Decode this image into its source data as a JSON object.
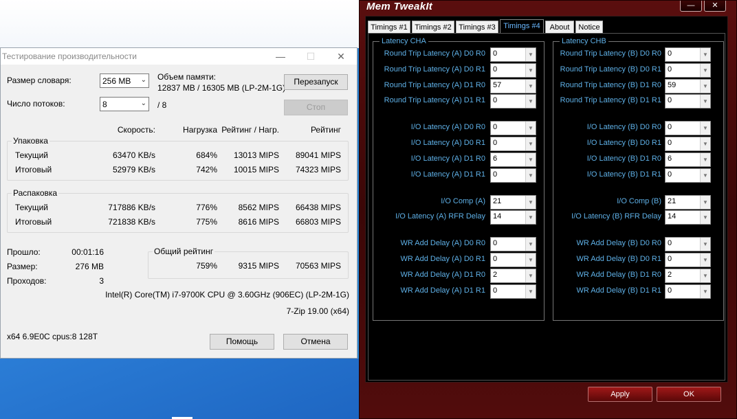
{
  "bench": {
    "title": "Тестирование производительности",
    "dict_label": "Размер словаря:",
    "dict_value": "256 MB",
    "threads_label": "Число потоков:",
    "threads_value": "8",
    "threads_max": "/ 8",
    "mem_label": "Объем памяти:",
    "mem_value": "12837 MB / 16305 MB (LP-2M-1G)",
    "restart_btn": "Перезапуск",
    "stop_btn": "Стоп",
    "col_speed": "Скорость:",
    "col_load": "Нагрузка",
    "col_rating_load": "Рейтинг / Нагр.",
    "col_rating": "Рейтинг",
    "pack": {
      "caption": "Упаковка",
      "rows": [
        {
          "label": "Текущий",
          "speed": "63470 KB/s",
          "load": "684%",
          "rl": "13013 MIPS",
          "rating": "89041 MIPS"
        },
        {
          "label": "Итоговый",
          "speed": "52979 KB/s",
          "load": "742%",
          "rl": "10015 MIPS",
          "rating": "74323 MIPS"
        }
      ]
    },
    "unpack": {
      "caption": "Распаковка",
      "rows": [
        {
          "label": "Текущий",
          "speed": "717886 KB/s",
          "load": "776%",
          "rl": "8562 MIPS",
          "rating": "66438 MIPS"
        },
        {
          "label": "Итоговый",
          "speed": "721838 KB/s",
          "load": "775%",
          "rl": "8616 MIPS",
          "rating": "66803 MIPS"
        }
      ]
    },
    "elapsed_label": "Прошло:",
    "elapsed_value": "00:01:16",
    "size_label": "Размер:",
    "size_value": "276 MB",
    "passes_label": "Проходов:",
    "passes_value": "3",
    "total": {
      "caption": "Общий рейтинг",
      "load": "759%",
      "rl": "9315 MIPS",
      "rating": "70563 MIPS"
    },
    "cpu_info": "Intel(R) Core(TM) i7-9700K CPU @ 3.60GHz (906EC) (LP-2M-1G)",
    "version": "7-Zip 19.00 (x64)",
    "sys_info": "x64 6.9E0C cpus:8 128T",
    "help_btn": "Помощь",
    "cancel_btn": "Отмена"
  },
  "mt": {
    "title": "Mem TweakIt",
    "tabs": [
      "Timings #1",
      "Timings #2",
      "Timings #3",
      "Timings #4",
      "About",
      "Notice"
    ],
    "active_tab": "Timings #4",
    "cha": {
      "caption": "Latency CHA",
      "fields": [
        {
          "label": "Round Trip Latency (A) D0 R0",
          "value": "0"
        },
        {
          "label": "Round Trip Latency (A) D0 R1",
          "value": "0"
        },
        {
          "label": "Round Trip Latency (A) D1 R0",
          "value": "57"
        },
        {
          "label": "Round Trip Latency (A) D1 R1",
          "value": "0"
        },
        {
          "label": "I/O Latency (A) D0 R0",
          "value": "0"
        },
        {
          "label": "I/O Latency (A) D0 R1",
          "value": "0"
        },
        {
          "label": "I/O Latency (A) D1 R0",
          "value": "6"
        },
        {
          "label": "I/O Latency (A) D1 R1",
          "value": "0"
        },
        {
          "label": "I/O Comp (A)",
          "value": "21"
        },
        {
          "label": "I/O Latency (A) RFR Delay",
          "value": "14"
        },
        {
          "label": "WR Add Delay (A) D0 R0",
          "value": "0"
        },
        {
          "label": "WR Add Delay (A) D0 R1",
          "value": "0"
        },
        {
          "label": "WR Add Delay (A) D1 R0",
          "value": "2"
        },
        {
          "label": "WR Add Delay (A) D1 R1",
          "value": "0"
        }
      ]
    },
    "chb": {
      "caption": "Latency CHB",
      "fields": [
        {
          "label": "Round Trip Latency (B) D0 R0",
          "value": "0"
        },
        {
          "label": "Round Trip Latency (B) D0 R1",
          "value": "0"
        },
        {
          "label": "Round Trip Latency (B) D1 R0",
          "value": "59"
        },
        {
          "label": "Round Trip Latency (B) D1 R1",
          "value": "0"
        },
        {
          "label": "I/O Latency (B) D0 R0",
          "value": "0"
        },
        {
          "label": "I/O Latency (B) D0 R1",
          "value": "0"
        },
        {
          "label": "I/O Latency (B) D1 R0",
          "value": "6"
        },
        {
          "label": "I/O Latency (B) D1 R1",
          "value": "0"
        },
        {
          "label": "I/O Comp (B)",
          "value": "21"
        },
        {
          "label": "I/O Latency (B) RFR Delay",
          "value": "14"
        },
        {
          "label": "WR Add Delay (B) D0 R0",
          "value": "0"
        },
        {
          "label": "WR Add Delay (B) D0 R1",
          "value": "0"
        },
        {
          "label": "WR Add Delay (B) D1 R0",
          "value": "2"
        },
        {
          "label": "WR Add Delay (B) D1 R1",
          "value": "0"
        }
      ]
    },
    "apply_btn": "Apply",
    "ok_btn": "OK"
  }
}
